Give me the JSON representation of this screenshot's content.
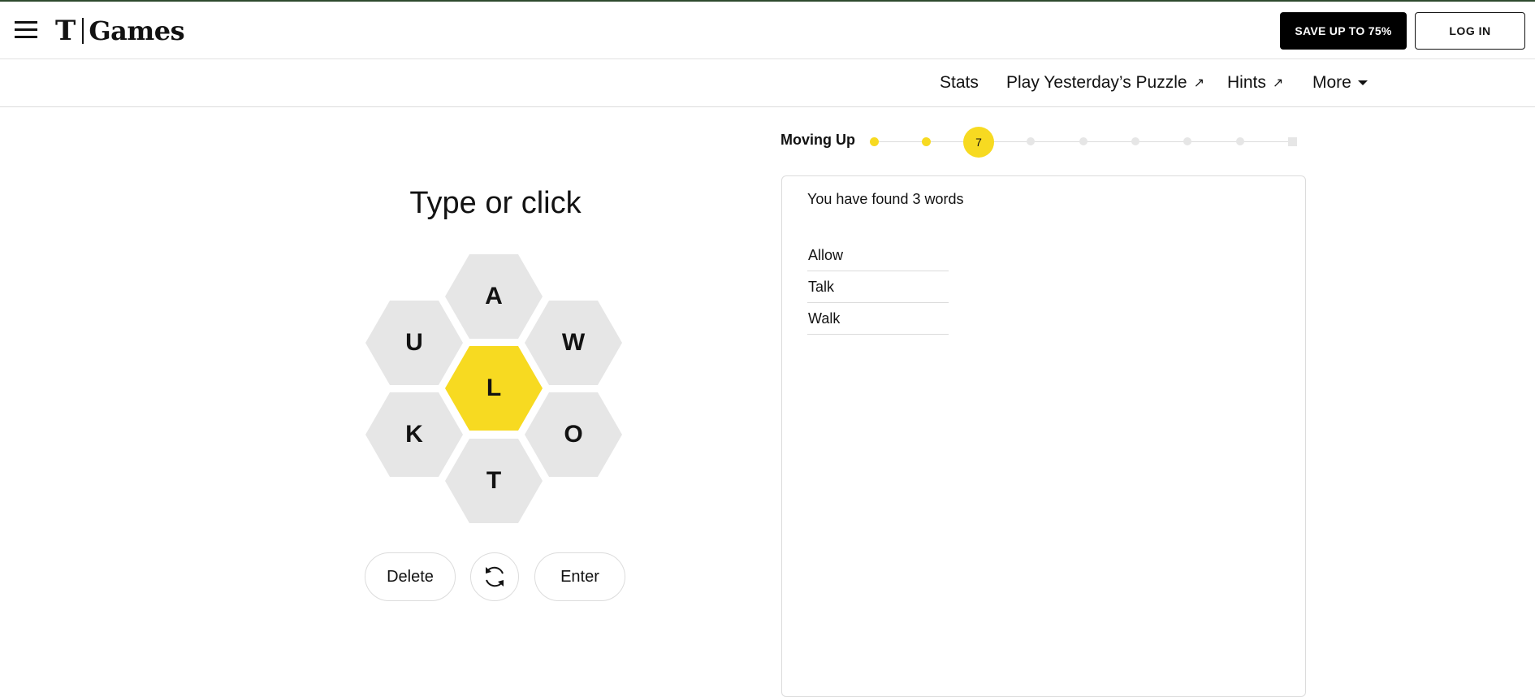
{
  "header": {
    "brand_mark": "T",
    "brand_name": "Games",
    "save_label": "SAVE UP TO 75%",
    "login_label": "LOG IN",
    "colors": {
      "save_bg": "#000000",
      "accent_line": "#2e4a2e"
    }
  },
  "subnav": {
    "stats": "Stats",
    "yesterday": "Play Yesterday’s Puzzle",
    "hints": "Hints",
    "more": "More",
    "external_icon": "arrow-up-right-icon"
  },
  "progress": {
    "rank": "Moving Up",
    "score": "7",
    "levels_total": 9,
    "current_level_index": 2,
    "accent": "#f7da21"
  },
  "game": {
    "prompt": "Type or click",
    "center_letter": "L",
    "outer_letters": {
      "top": "A",
      "upper_left": "U",
      "upper_right": "W",
      "lower_left": "K",
      "lower_right": "O",
      "bottom": "T"
    },
    "delete_label": "Delete",
    "shuffle_icon": "shuffle-icon",
    "enter_label": "Enter",
    "colors": {
      "center": "#f7da21",
      "outer": "#e6e6e6"
    }
  },
  "words": {
    "found_text": "You have found 3 words",
    "list": [
      "Allow",
      "Talk",
      "Walk"
    ]
  }
}
